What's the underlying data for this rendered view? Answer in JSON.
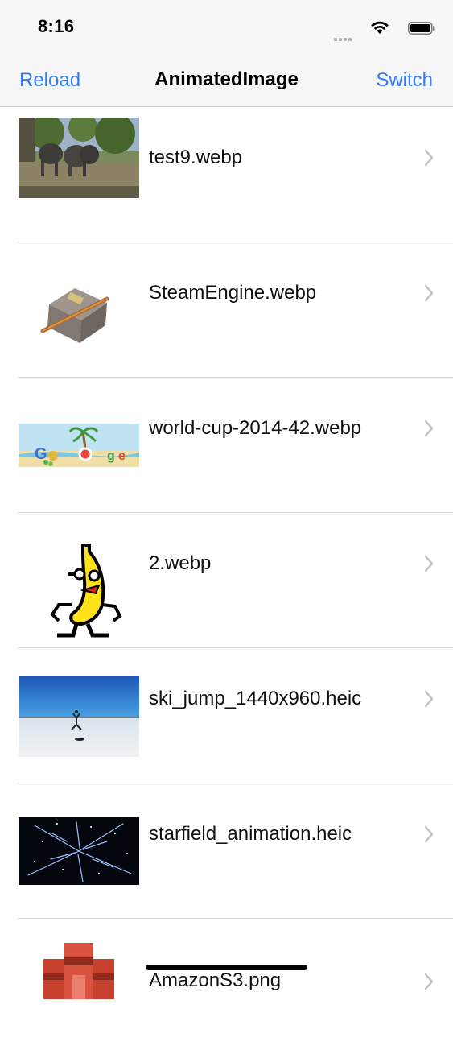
{
  "status": {
    "time": "8:16"
  },
  "nav": {
    "left_label": "Reload",
    "title": "AnimatedImage",
    "right_label": "Switch"
  },
  "rows": [
    {
      "label": "test9.webp"
    },
    {
      "label": "SteamEngine.webp"
    },
    {
      "label": "world-cup-2014-42.webp"
    },
    {
      "label": "2.webp"
    },
    {
      "label": "ski_jump_1440x960.heic"
    },
    {
      "label": "starfield_animation.heic"
    },
    {
      "label": "AmazonS3.png"
    }
  ],
  "colors": {
    "tint": "#2f7cf6",
    "chevron": "#c4c4c7",
    "separator": "#dcdcde",
    "bar": "#f7f7f7"
  }
}
